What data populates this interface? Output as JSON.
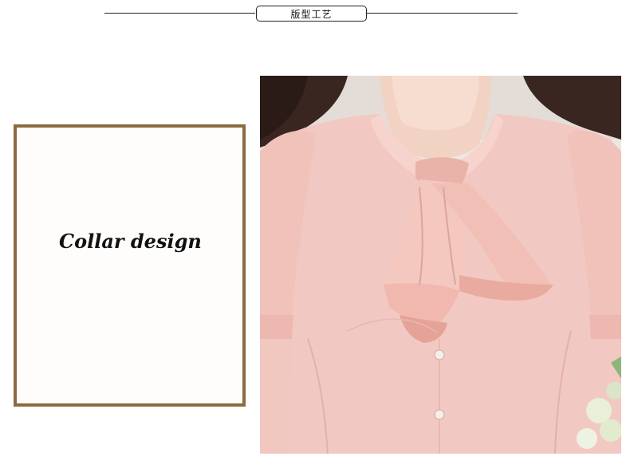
{
  "header": {
    "title": "版型工艺"
  },
  "card": {
    "caption": "Collar design"
  },
  "photo": {
    "subject": "pink-ruffle-collar-blouse",
    "colors": {
      "blouse": "#f2c9c2",
      "blouse_shadow": "#dba59d",
      "hair": "#3a2620",
      "skin": "#f1d2c3",
      "background": "#e9e4df",
      "frame": "#8c6a3f"
    }
  }
}
